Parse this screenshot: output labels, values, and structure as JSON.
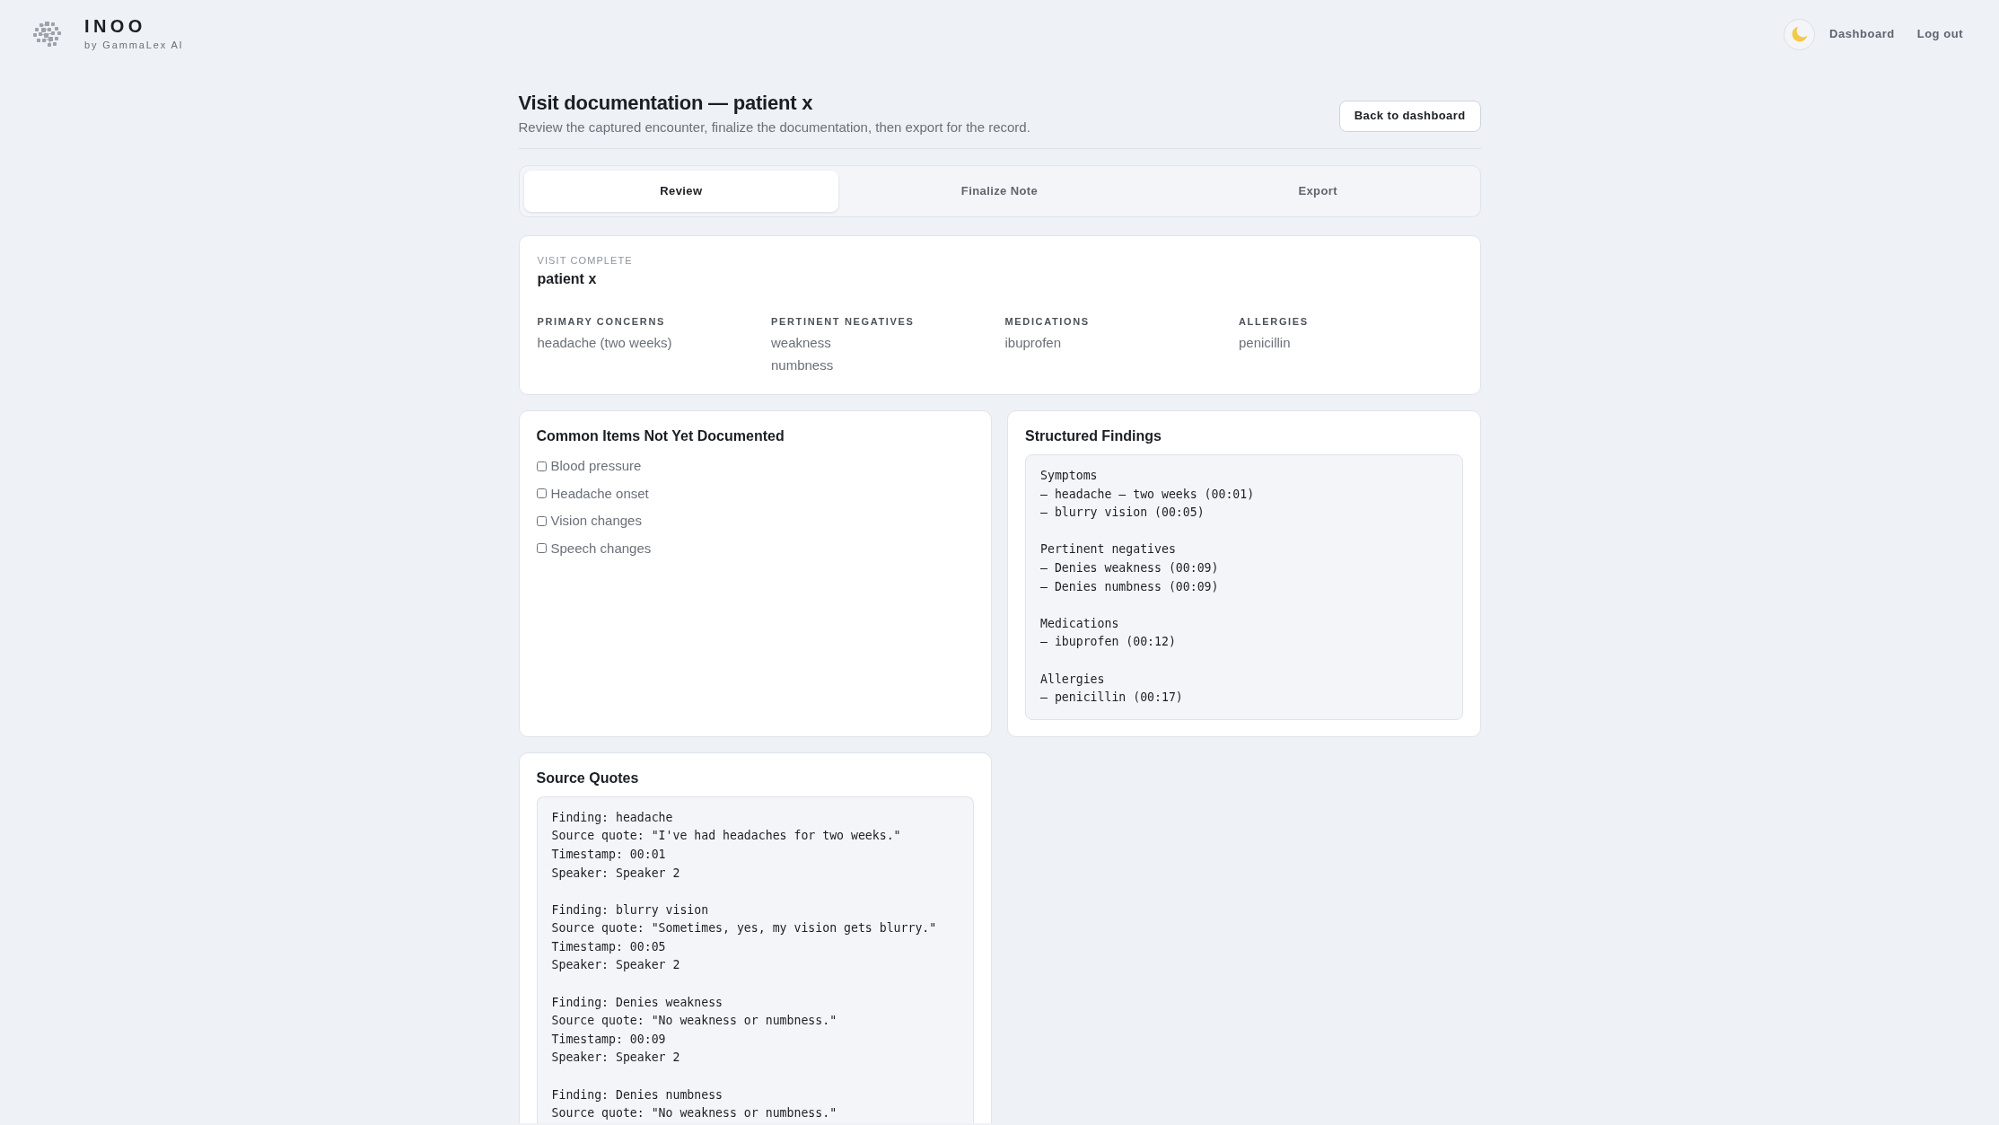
{
  "header": {
    "brand": "INOO",
    "tagline": "by GammaLex AI",
    "nav_links": [
      "Dashboard",
      "Log out"
    ]
  },
  "page": {
    "title": "Visit documentation — patient x",
    "subtitle": "Review the captured encounter, finalize the documentation, then export for the record.",
    "back_button": "Back to dashboard"
  },
  "tabs": [
    {
      "label": "Review",
      "selected": true
    },
    {
      "label": "Finalize Note",
      "selected": false
    },
    {
      "label": "Export",
      "selected": false
    }
  ],
  "visit_summary": {
    "status": "VISIT COMPLETE",
    "patient": "patient x",
    "fields": [
      {
        "label": "PRIMARY CONCERNS",
        "values": [
          "headache (two weeks)"
        ]
      },
      {
        "label": "PERTINENT NEGATIVES",
        "values": [
          "weakness",
          "numbness"
        ]
      },
      {
        "label": "MEDICATIONS",
        "values": [
          "ibuprofen"
        ]
      },
      {
        "label": "ALLERGIES",
        "values": [
          "penicillin"
        ]
      }
    ]
  },
  "checklist": {
    "title": "Common Items Not Yet Documented",
    "items": [
      {
        "label": "Blood pressure",
        "checked": false
      },
      {
        "label": "Headache onset",
        "checked": false
      },
      {
        "label": "Vision changes",
        "checked": false
      },
      {
        "label": "Speech changes",
        "checked": false
      }
    ]
  },
  "structured_findings": {
    "title": "Structured Findings",
    "sections": [
      {
        "heading": "Symptoms",
        "lines": [
          "– headache – two weeks (00:01)",
          "– blurry vision (00:05)"
        ]
      },
      {
        "heading": "Pertinent negatives",
        "lines": [
          "– Denies weakness (00:09)",
          "– Denies numbness (00:09)"
        ]
      },
      {
        "heading": "Medications",
        "lines": [
          "– ibuprofen (00:12)"
        ]
      },
      {
        "heading": "Allergies",
        "lines": [
          "– penicillin (00:17)"
        ]
      }
    ]
  },
  "source_quotes": {
    "title": "Source Quotes",
    "entries": [
      {
        "lines": [
          "Finding: headache",
          "Source quote: \"I've had headaches for two weeks.\"",
          "Timestamp: 00:01",
          "Speaker: Speaker 2"
        ]
      },
      {
        "lines": [
          "Finding: blurry vision",
          "Source quote: \"Sometimes, yes, my vision gets blurry.\"",
          "Timestamp: 00:05",
          "Speaker: Speaker 2"
        ]
      },
      {
        "lines": [
          "Finding: Denies weakness",
          "Source quote: \"No weakness or numbness.\"",
          "Timestamp: 00:09",
          "Speaker: Speaker 2"
        ]
      },
      {
        "lines": [
          "Finding: Denies numbness",
          "Source quote: \"No weakness or numbness.\""
        ]
      }
    ]
  }
}
